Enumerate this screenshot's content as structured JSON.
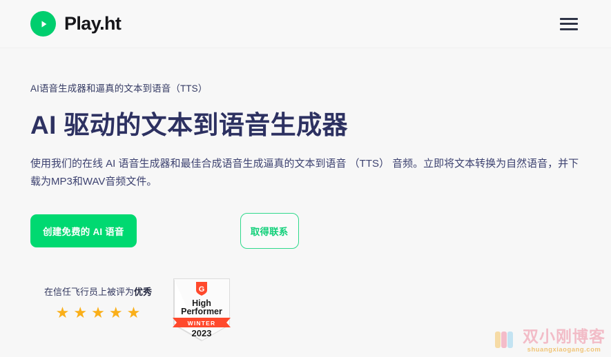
{
  "page": {
    "background_color": "#f7f7f7"
  },
  "header": {
    "brand_name": "Play.ht",
    "logo_icon": "play-circle-icon",
    "logo_color": "#00ce6e",
    "menu_icon": "hamburger-menu-icon",
    "menu_color": "#2e3346"
  },
  "hero": {
    "eyebrow": "AI语音生成器和逼真的文本到语音（TTS）",
    "headline": "AI 驱动的文本到语音生成器",
    "subcopy": "使用我们的在线 AI 语音生成器和最佳合成语音生成逼真的文本到语音 （TTS） 音频。立即将文本转换为自然语音，并下载为MP3和WAV音频文件。",
    "headline_color": "#2d3161",
    "body_color": "#3d4270"
  },
  "cta": {
    "primary_label": "创建免费的 AI 语音",
    "primary_color": "#00d971",
    "secondary_label": "取得联系",
    "secondary_color": "#12d07a"
  },
  "trust": {
    "text_prefix": "在信任飞行员上被评为",
    "text_highlight": "优秀",
    "star_count": 5,
    "star_glyph": "★",
    "star_color": "#faaf19"
  },
  "g2_badge": {
    "logo_text": "G",
    "title_line_1": "High",
    "title_line_2": "Performer",
    "season": "WINTER",
    "year": "2023",
    "accent_color": "#ff492c",
    "shield_fill": "#ffffff"
  },
  "watermark": {
    "title": "双小刚博客",
    "url": "shuangxiaogang.com"
  }
}
